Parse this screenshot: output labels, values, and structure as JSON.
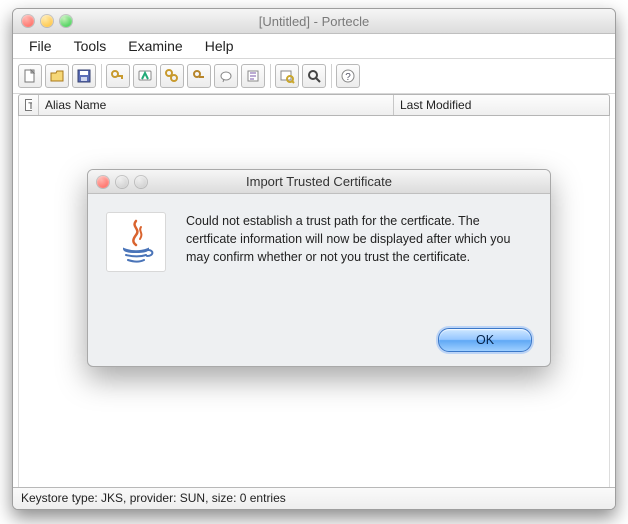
{
  "window": {
    "title": "[Untitled] - Portecle"
  },
  "menubar": [
    "File",
    "Tools",
    "Examine",
    "Help"
  ],
  "toolbar_icons": [
    "new-keystore-icon",
    "open-keystore-icon",
    "save-icon",
    "SEP",
    "generate-keypair-icon",
    "import-trusted-icon",
    "import-keypair-icon",
    "set-password-icon",
    "report-icon",
    "sign-icon",
    "SEP",
    "examine-cert-icon",
    "examine-crl-icon",
    "SEP",
    "help-icon"
  ],
  "table": {
    "icon_header": "",
    "headers": {
      "alias": "Alias Name",
      "modified": "Last Modified"
    }
  },
  "statusbar": "Keystore type: JKS, provider: SUN, size: 0 entries",
  "dialog": {
    "title": "Import Trusted Certificate",
    "message": "Could not establish a trust path for the certficate. The certficate information will now be displayed after which you may confirm whether or not you trust the certificate.",
    "ok": "OK"
  }
}
